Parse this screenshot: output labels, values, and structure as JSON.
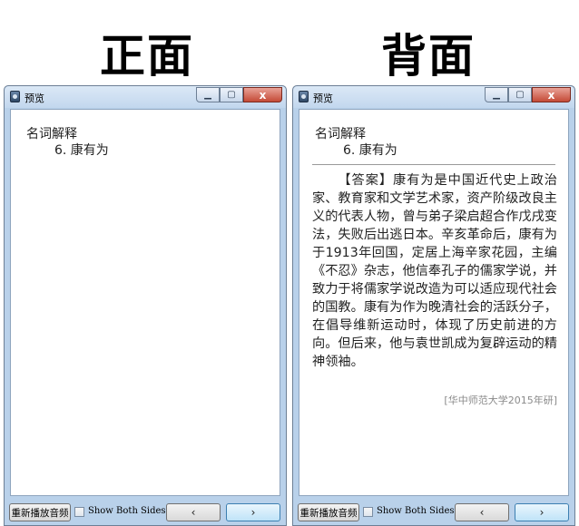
{
  "headings": {
    "front": "正面",
    "back": "背面"
  },
  "window": {
    "title": "预览",
    "minimize_icon": "minimize-icon",
    "maximize_icon": "maximize-icon",
    "close_icon": "close-icon",
    "close_symbol": "x"
  },
  "card": {
    "question_label": "名词解释",
    "question_item": "6. 康有为",
    "answer": "【答案】康有为是中国近代史上政治家、教育家和文学艺术家，资产阶级改良主义的代表人物，曾与弟子梁启超合作戊戌变法，失败后出逃日本。辛亥革命后，康有为于1913年回国，定居上海辛家花园，主编《不忍》杂志，他信奉孔子的儒家学说，并致力于将儒家学说改造为可以适应现代社会的国教。康有为作为晚清社会的活跃分子，在倡导维新运动时，体现了历史前进的方向。但后来，他与袁世凯成为复辟运动的精神领袖。",
    "source": "[华中师范大学2015年研]"
  },
  "toolbar": {
    "replay_label": "重新播放音频",
    "show_both_sides_label": "Show Both Sides",
    "show_both_sides_checked": false,
    "prev_symbol": "‹",
    "next_symbol": "›"
  }
}
